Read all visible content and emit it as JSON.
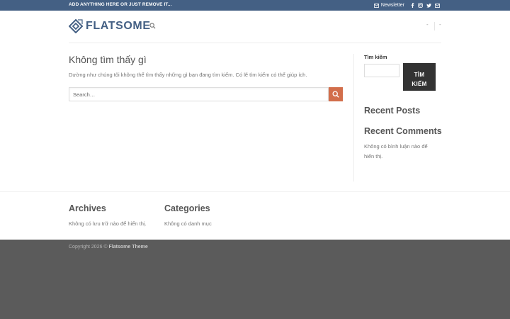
{
  "topbar": {
    "message": "ADD ANYTHING HERE OR JUST REMOVE IT...",
    "newsletter_label": "Newsletter",
    "social_icons": [
      "facebook-icon",
      "instagram-icon",
      "twitter-icon",
      "mail-icon"
    ],
    "background": "#446084"
  },
  "header": {
    "logo_text": "FLATSOME",
    "dash_1": "-",
    "dash_2": "-"
  },
  "main": {
    "title": "Không tìm thấy gì",
    "description": "Dường như chúng tôi không thể tìm thấy những gì bạn đang tìm kiếm. Có lẽ tìm kiếm có thể giúp ích.",
    "search_placeholder": "Search…"
  },
  "sidebar": {
    "search_title": "Tìm kiếm",
    "search_button_line1": "TÌM",
    "search_button_line2": "KIẾM",
    "recent_posts_title": "Recent Posts",
    "recent_comments_title": "Recent Comments",
    "no_comments_text": "Không có bình luận nào để hiển thị."
  },
  "footer": {
    "archives_title": "Archives",
    "archives_text": "Không có lưu trữ nào để hiển thị.",
    "categories_title": "Categories",
    "categories_text": "Không có danh mục",
    "copyright_prefix": "Copyright 2026 © ",
    "copyright_brand": "Flatsome Theme"
  },
  "colors": {
    "accent": "#d26e4b",
    "primary": "#446084",
    "footer_bg": "#5b5b5b"
  }
}
